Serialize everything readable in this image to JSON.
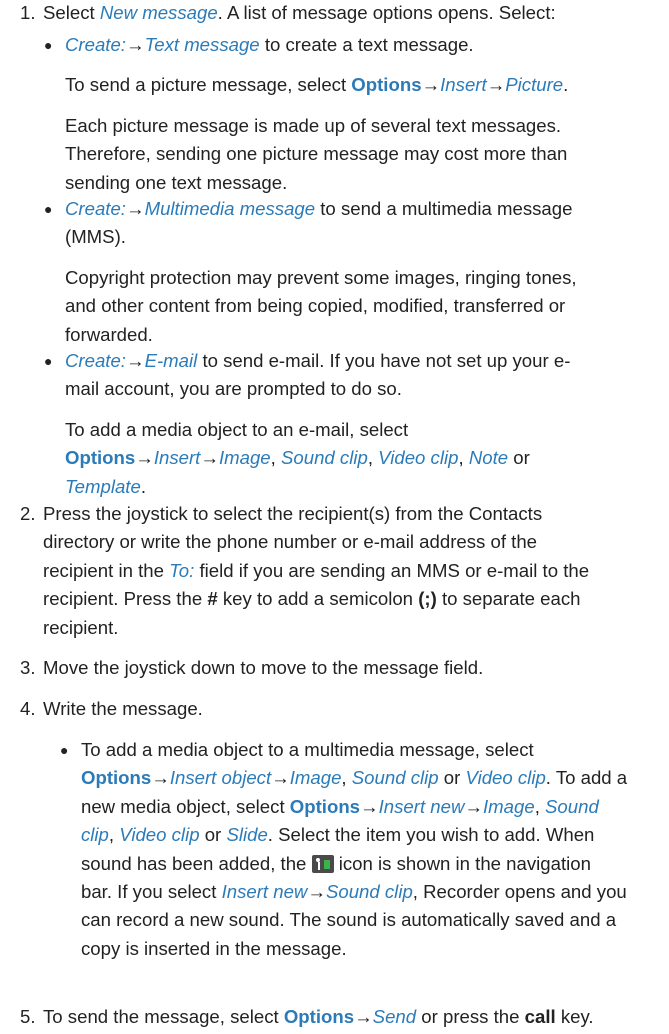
{
  "step1": {
    "number": "1.",
    "select": "Select",
    "new_message": "New message",
    "after": ". A list of message options opens. Select:",
    "text_bullet": {
      "create": "Create:",
      "arrow": "→",
      "text_message": "Text message",
      "rest": "to create a text message."
    },
    "picture_para": {
      "lead": "To send a picture message, select",
      "options": "Options",
      "insert": "Insert",
      "picture": "Picture",
      "period": "."
    },
    "picture_note": [
      "Each picture message is made up of several text messages.",
      "Therefore, sending one picture message may cost more than",
      "sending one text message."
    ],
    "mms_bullet": {
      "create": "Create:",
      "multimedia_message": "Multimedia message",
      "line1_rest": "to send a multimedia message",
      "line2": "(MMS)."
    },
    "copyright": [
      "Copyright protection may prevent some images, ringing tones,",
      "and other content from being copied, modified, transferred or",
      "forwarded."
    ],
    "email_bullet": {
      "create": "Create:",
      "email": "E-mail",
      "line1_rest": "to send e-mail. If you have not set up your e-",
      "line2": "mail account, you are prompted to do so."
    },
    "email_media": {
      "line1": "To add a media object to an e-mail, select",
      "options": "Options",
      "insert": "Insert",
      "image": "Image",
      "sound_clip": "Sound clip",
      "video_clip": "Video clip",
      "note": "Note",
      "or": "or",
      "template": "Template",
      "comma": ",",
      "period": "."
    }
  },
  "step2": {
    "number": "2.",
    "line1": "Press the joystick to select the recipient(s) from the Contacts",
    "line2": "directory or write the phone number or e-mail address of the",
    "line3_a": "recipient in the",
    "to_field": "To:",
    "line3_b": "field if you are sending an MMS or e-mail to the",
    "line4_a": "recipient. Press the",
    "hash": "#",
    "line4_b": "key to add a semicolon",
    "semicolon": "(;)",
    "line4_c": "to separate each",
    "line5": "recipient."
  },
  "step3": {
    "number": "3.",
    "text": "Move the joystick down to move to the message field."
  },
  "step4": {
    "number": "4.",
    "text": "Write the message.",
    "bullet": {
      "line1": "To add a media object to a multimedia message, select",
      "options": "Options",
      "insert_object": "Insert object",
      "image": "Image",
      "sound_clip": "Sound clip",
      "video_clip": "Video clip",
      "or": "or",
      "to_add_a": "To add a",
      "line3_a": "new media object, select",
      "insert_new": "Insert new",
      "sound": "Sound",
      "clip": "clip",
      "slide": "Slide",
      "line4_rest": ". Select the item you wish to add. When",
      "line5_a": "sound has been added, the",
      "icon": "music-note-icon",
      "line5_b": "icon is shown in the navigation",
      "line6_a": "bar. If you select",
      "line6_b": ", Recorder opens and you",
      "line7": "can record a new sound. The sound is automatically saved and a",
      "line8": "copy is inserted in the message.",
      "comma": ",",
      "period": "."
    }
  },
  "step5": {
    "number": "5.",
    "lead": "To send the message, select",
    "options": "Options",
    "send": "Send",
    "or_press": "or press the",
    "call": "call",
    "key": "key."
  },
  "colors": {
    "accent": "#2b7bb9",
    "text": "#222222"
  }
}
